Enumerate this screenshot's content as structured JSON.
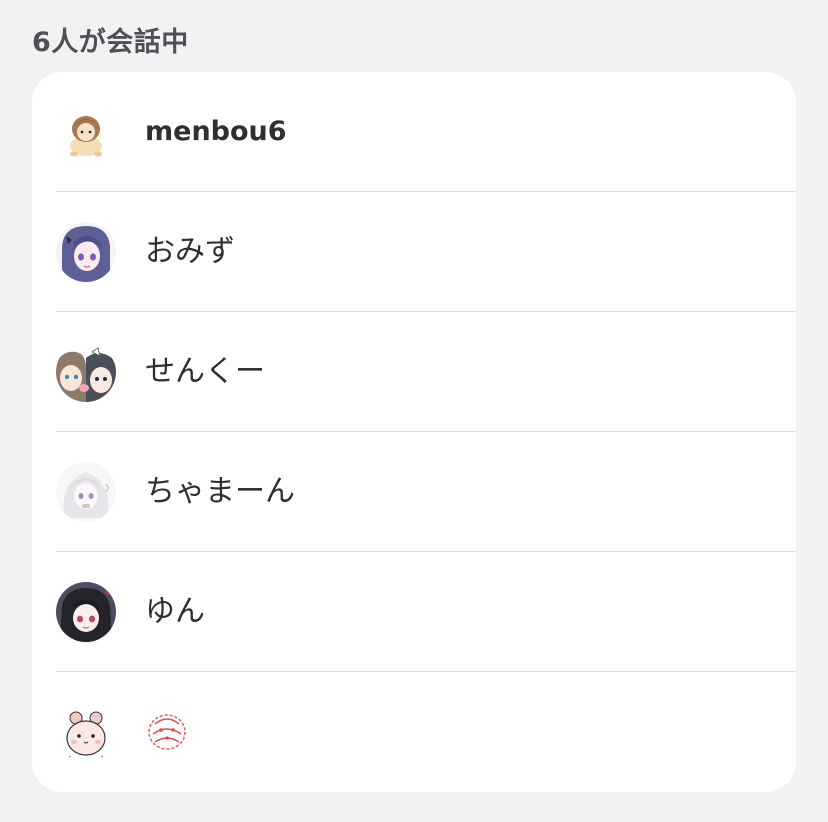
{
  "header": {
    "title": "6人が会話中"
  },
  "participants": [
    {
      "name": "menbou6",
      "avatar": "brown-hair-chibi-avatar"
    },
    {
      "name": "おみず",
      "avatar": "purple-hair-girl-avatar"
    },
    {
      "name": "せんくー",
      "avatar": "two-characters-avatar"
    },
    {
      "name": "ちゃまーん",
      "avatar": "white-hair-character-avatar"
    },
    {
      "name": "ゆん",
      "avatar": "dark-hair-girl-avatar"
    },
    {
      "name": "",
      "avatar": "pink-hamster-avatar",
      "name_icon": "red-pattern-emoji"
    }
  ]
}
